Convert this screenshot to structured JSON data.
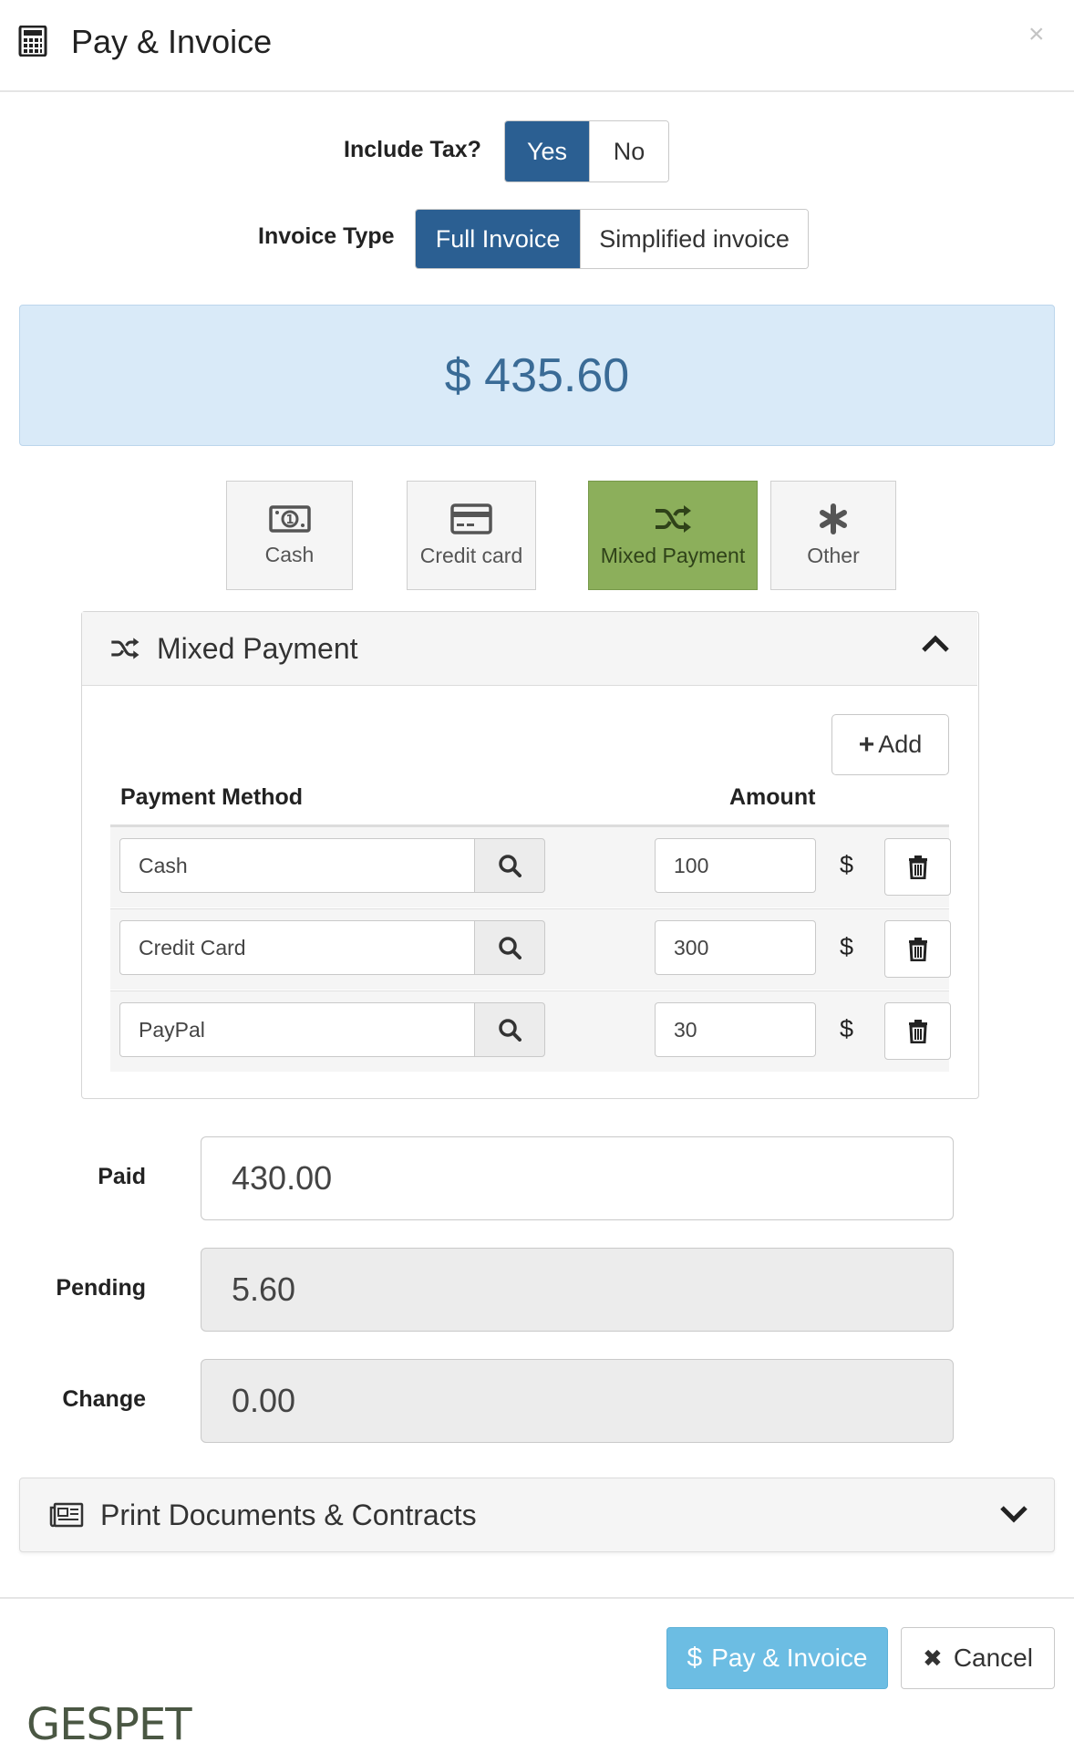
{
  "header": {
    "title": "Pay & Invoice",
    "icon": "calculator-icon",
    "close_label": "×"
  },
  "include_tax": {
    "label": "Include Tax?",
    "options": [
      "Yes",
      "No"
    ],
    "selected": "Yes"
  },
  "invoice_type": {
    "label": "Invoice Type",
    "options": [
      "Full Invoice",
      "Simplified invoice"
    ],
    "selected": "Full Invoice"
  },
  "total": {
    "display": "$ 435.60"
  },
  "payment_types": [
    {
      "label": "Cash",
      "icon": "banknote-icon",
      "active": false
    },
    {
      "label": "Credit card",
      "icon": "credit-card-icon",
      "active": false
    },
    {
      "label": "Mixed Payment",
      "icon": "shuffle-icon",
      "active": true
    },
    {
      "label": "Other",
      "icon": "asterisk-icon",
      "active": false
    }
  ],
  "mixed_panel": {
    "title": "Mixed Payment",
    "add_label": "Add",
    "columns": {
      "method": "Payment Method",
      "amount": "Amount"
    },
    "rows": [
      {
        "method": "Cash",
        "amount": "100",
        "currency": "$"
      },
      {
        "method": "Credit Card",
        "amount": "300",
        "currency": "$"
      },
      {
        "method": "PayPal",
        "amount": "30",
        "currency": "$"
      }
    ]
  },
  "summary": {
    "paid": {
      "label": "Paid",
      "value": "430.00"
    },
    "pending": {
      "label": "Pending",
      "value": "5.60"
    },
    "change": {
      "label": "Change",
      "value": "0.00"
    }
  },
  "print_docs": {
    "title": "Print Documents & Contracts"
  },
  "footer": {
    "pay_label": "Pay & Invoice",
    "pay_currency": "$",
    "cancel_label": "Cancel",
    "logo": "GESPET"
  },
  "colors": {
    "primary": "#2b5f92",
    "total_bg": "#d9eaf8",
    "total_text": "#3a6b96",
    "active_tile": "#8caf5b",
    "pay_button": "#6cbde3"
  }
}
